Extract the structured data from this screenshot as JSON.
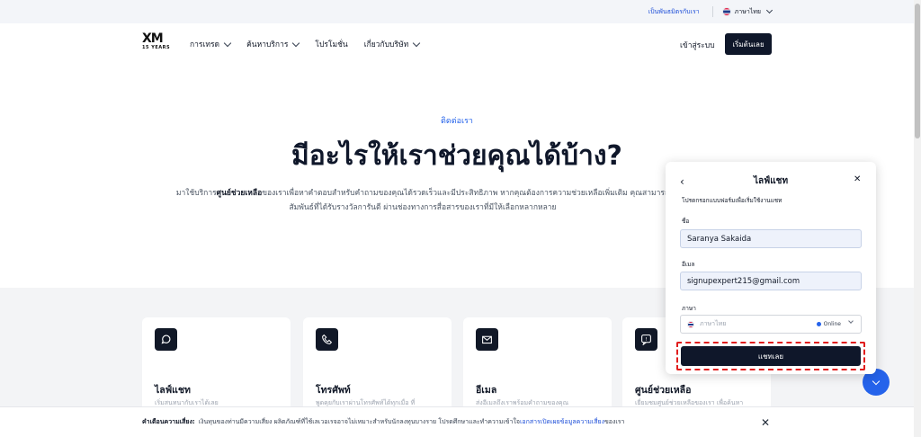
{
  "topbar": {
    "partner_link": "เป็นพันธมิตรกับเรา",
    "language": "ภาษาไทย"
  },
  "nav": {
    "logo_mark": "XM",
    "logo_years": "15 YEARS",
    "items": [
      {
        "label": "การเทรด",
        "has_dropdown": true
      },
      {
        "label": "ค้นหาบริการ",
        "has_dropdown": true
      },
      {
        "label": "โปรโมชั่น",
        "has_dropdown": false
      },
      {
        "label": "เกี่ยวกับบริษัท",
        "has_dropdown": true
      }
    ],
    "login": "เข้าสู่ระบบ",
    "start": "เริ่มต้นเลย"
  },
  "hero": {
    "eyebrow": "ติดต่อเรา",
    "headline": "มีอะไรให้เราช่วยคุณได้บ้าง?",
    "intro_prefix": "มาใช้บริการ",
    "intro_bold": "ศูนย์ช่วยเหลือ",
    "intro_rest": "ของเราเพื่อหาคำตอบสำหรับคำถามของคุณได้รวดเร็วและมีประสิทธิภาพ หากคุณต้องการความช่วยเหลือเพิ่มเติม คุณสามารถ",
    "intro_line2": "สัมพันธ์ที่ได้รับรางวัลการันตี ผ่านช่องทางการสื่อสารของเราที่มีให้เลือกหลากหลาย"
  },
  "cards": [
    {
      "icon": "chat-bubble-icon",
      "title": "ไลฟ์แชท",
      "sub": "เริ่มสนทนากับเราได้เลย"
    },
    {
      "icon": "phone-icon",
      "title": "โทรศัพท์",
      "sub": "พูดคุยกับเราผ่านโทรศัพท์ได้ทุกเมื่อ ที่"
    },
    {
      "icon": "mail-icon",
      "title": "อีเมล",
      "sub": "ส่งอีเมลถึงเราพร้อมคำถามของคุณ"
    },
    {
      "icon": "help-icon",
      "title": "ศูนย์ช่วยเหลือ",
      "sub": "เยี่ยมชมศูนย์ช่วยเหลือของเรา เพื่อค้นหา"
    }
  ],
  "chat": {
    "title": "ไลฟ์แชท",
    "instructions": "โปรดกรอกแบบฟอร์มเพื่อเริ่มใช้งานแชท",
    "name_label": "ชื่อ",
    "name_value": "Saranya Sakaida",
    "email_label": "อีเมล",
    "email_value": "signupexpert215@gmail.com",
    "language_label": "ภาษา",
    "language_placeholder": "ภาษาไทย",
    "status": "Online",
    "submit": "แชทเลย"
  },
  "risk": {
    "bold": "คำเตือนความเสี่ยง:",
    "text": "เงินทุนของท่านมีความเสี่ยง ผลิตภัณฑ์ที่ใช้เลเวอเรจอาจไม่เหมาะสำหรับนักลงทุนบางราย โปรดศึกษาและทำความเข้าใจ",
    "link": "เอกสารเปิดเผยข้อมูลความเสี่ยง",
    "suffix": "ของเรา"
  },
  "colors": {
    "accent": "#2563eb",
    "dark": "#0f172a",
    "highlight": "#e11d1d"
  }
}
